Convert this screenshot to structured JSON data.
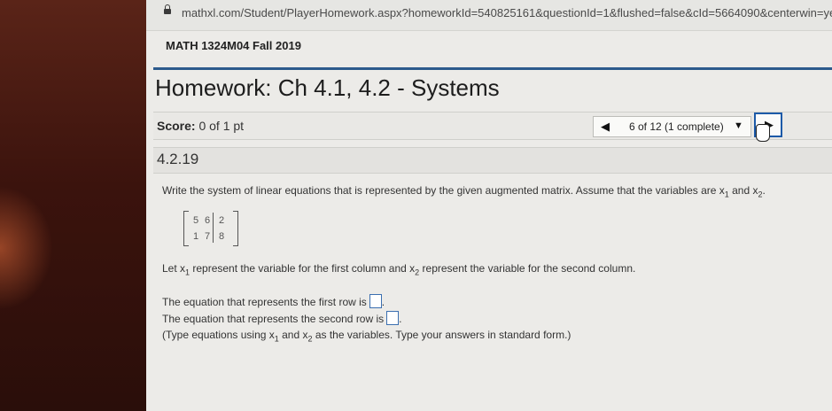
{
  "browser": {
    "url": "mathxl.com/Student/PlayerHomework.aspx?homeworkId=540825161&questionId=1&flushed=false&cId=5664090&centerwin=yes"
  },
  "course": "MATH 1324M04 Fall 2019",
  "homework_title": "Homework: Ch 4.1, 4.2 - Systems",
  "score": {
    "label": "Score:",
    "value": "0 of 1 pt"
  },
  "navigation": {
    "prev_icon": "◀",
    "question_label": "6 of 12 (1 complete)",
    "dropdown_icon": "▼",
    "next_icon": "▶"
  },
  "question": {
    "number": "4.2.19",
    "instruction_main": "Write the system of linear equations that is represented by the given augmented matrix. Assume that the variables are x",
    "instruction_sub1": "1",
    "instruction_and": " and x",
    "instruction_sub2": "2",
    "instruction_end": ".",
    "matrix": [
      [
        "5",
        "6",
        "2"
      ],
      [
        "1",
        "7",
        "8"
      ]
    ],
    "let_part1": "Let x",
    "let_sub1": "1",
    "let_part2": " represent the variable for the first column and x",
    "let_sub2": "2",
    "let_part3": " represent the variable for the second column.",
    "first_row_label": "The equation that represents the first row is",
    "second_row_label": "The equation that represents the second row is",
    "answer_suffix": ".",
    "hint_part1": "(Type equations using x",
    "hint_sub1": "1",
    "hint_part2": " and x",
    "hint_sub2": "2",
    "hint_part3": " as the variables. Type your answers in standard form.)"
  }
}
